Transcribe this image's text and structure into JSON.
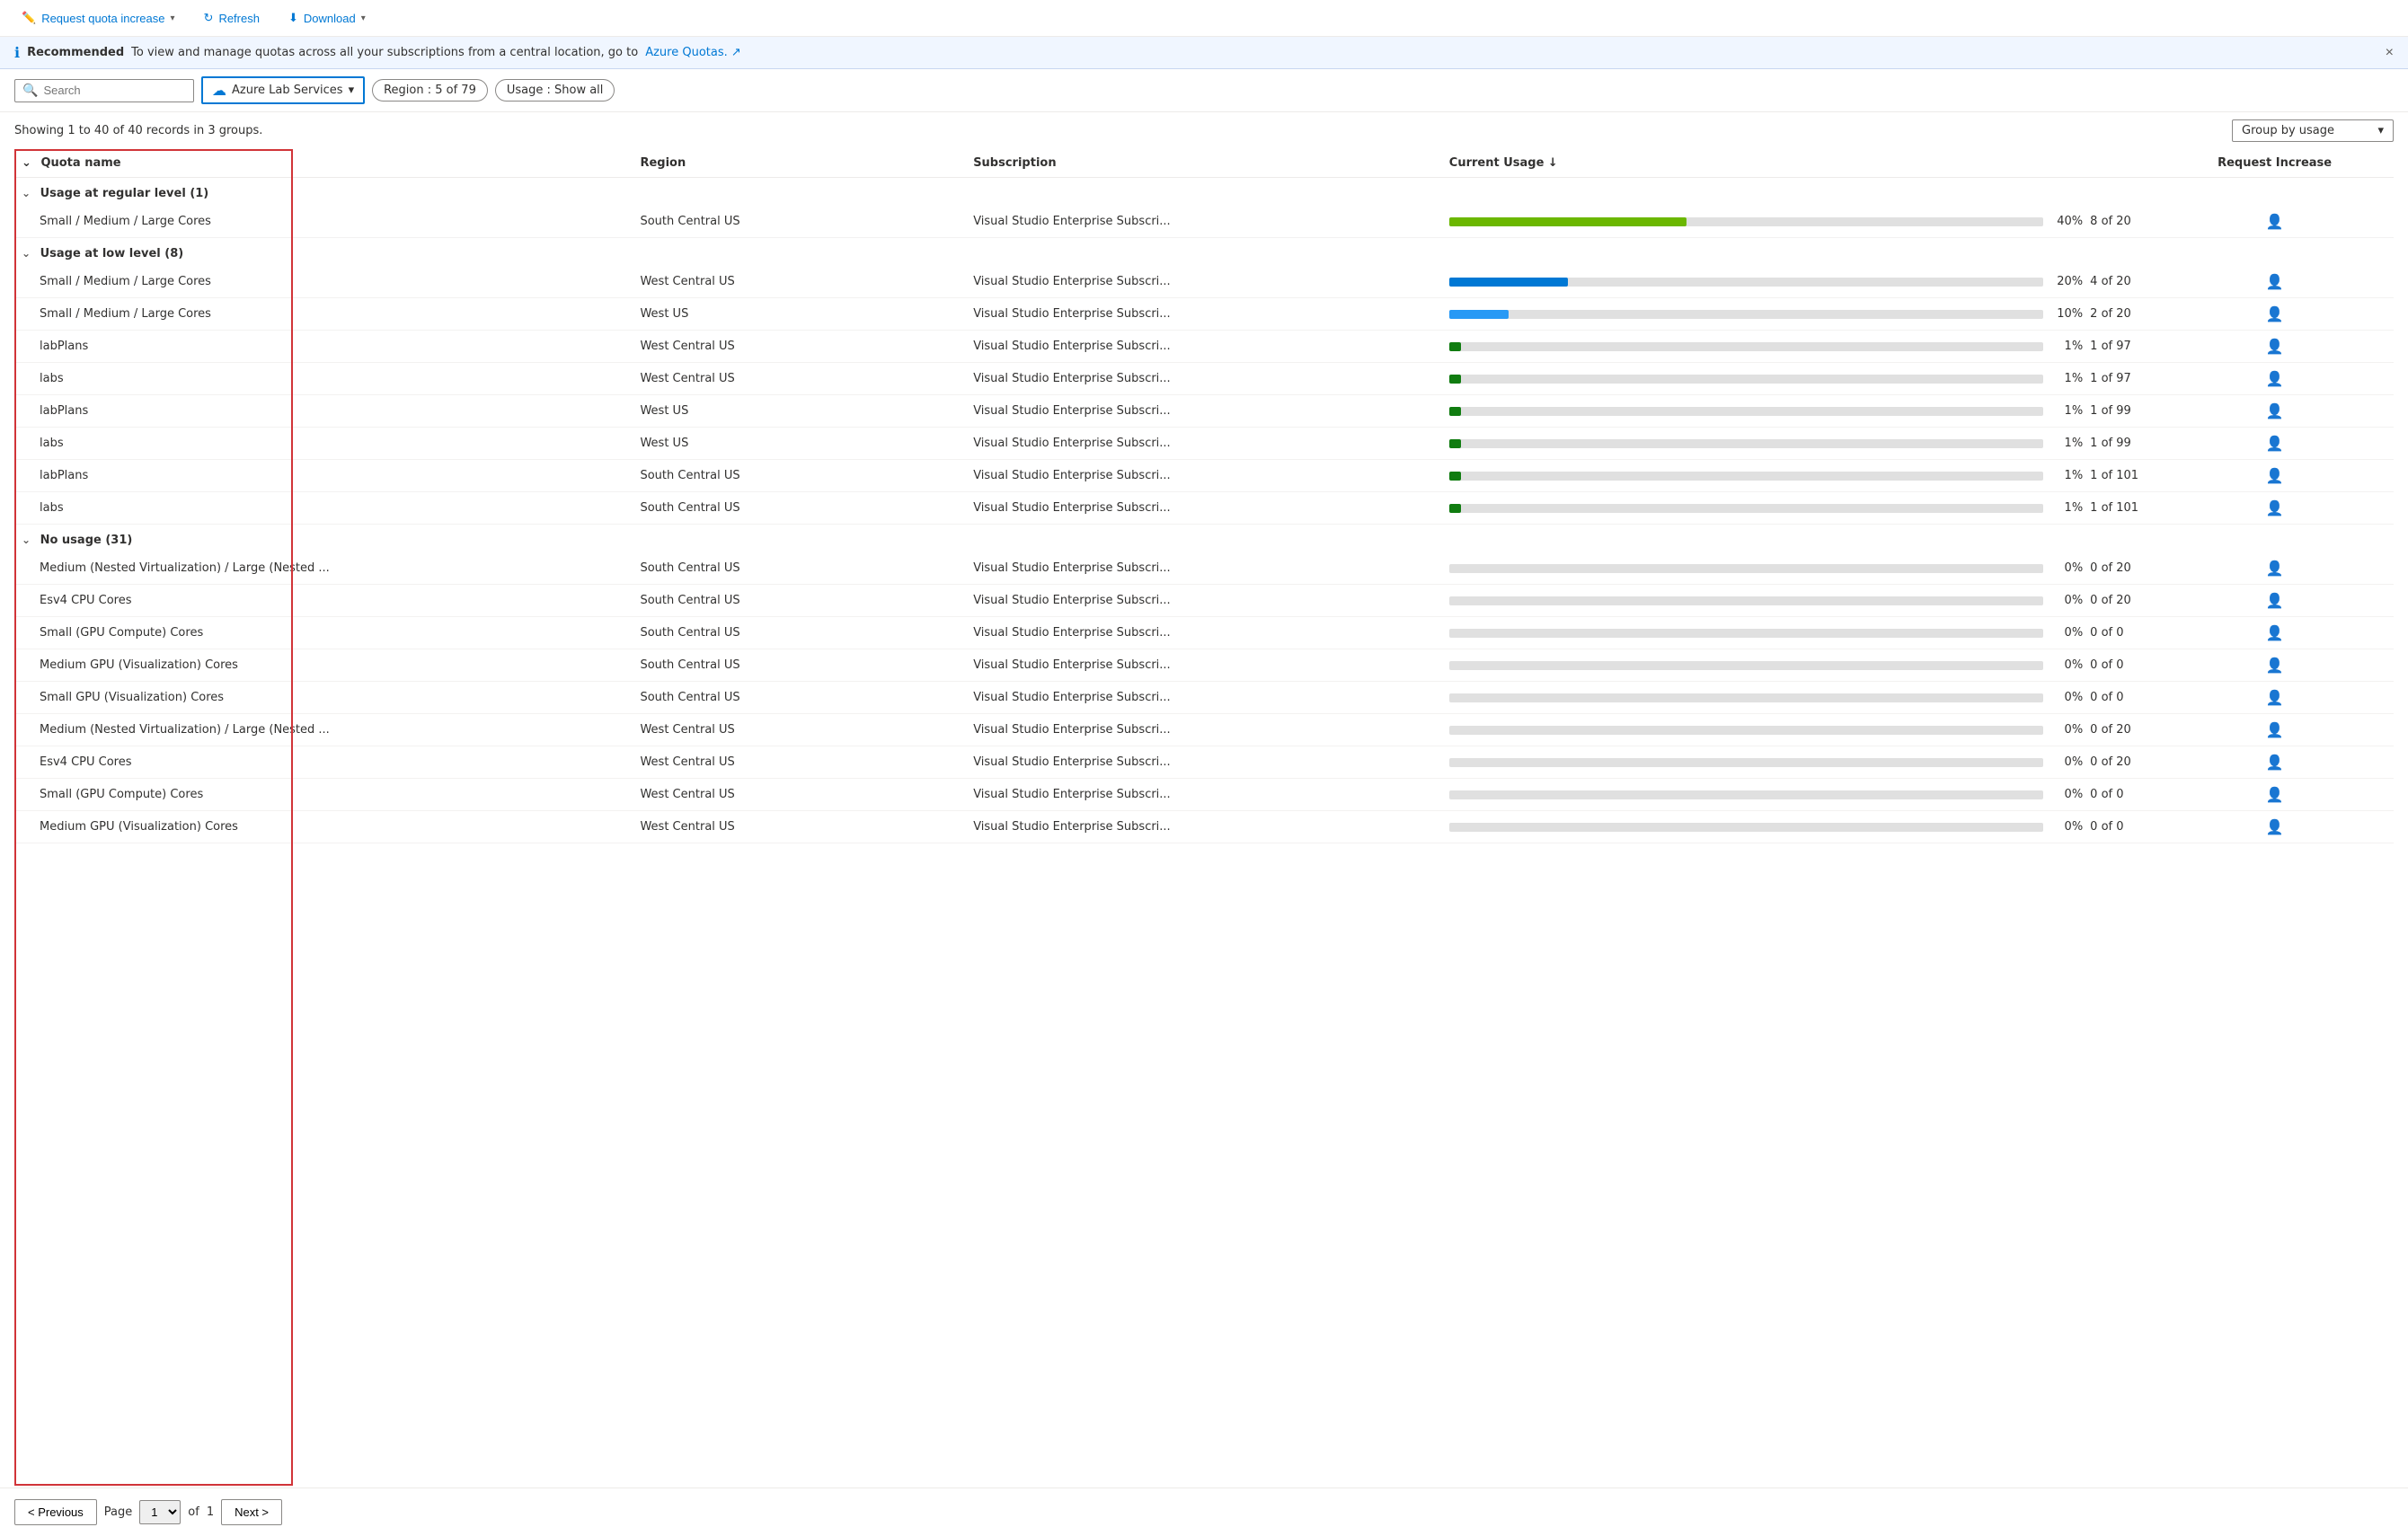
{
  "toolbar": {
    "request_quota_label": "Request quota increase",
    "refresh_label": "Refresh",
    "download_label": "Download"
  },
  "banner": {
    "badge": "Recommended",
    "text": "To view and manage quotas across all your subscriptions from a central location, go to",
    "link_text": "Azure Quotas.",
    "close_label": "×"
  },
  "filter_bar": {
    "search_placeholder": "Search",
    "service_label": "Azure Lab Services",
    "region_label": "Region : 5 of 79",
    "usage_label": "Usage : Show all"
  },
  "summary": {
    "text": "Showing 1 to 40 of 40 records in 3 groups.",
    "group_by_label": "Group by usage"
  },
  "table": {
    "headers": {
      "name": "Quota name",
      "region": "Region",
      "subscription": "Subscription",
      "current_usage": "Current Usage ↓",
      "request_increase": "Request Increase"
    },
    "groups": [
      {
        "id": "regular",
        "label": "Usage at regular level (1)",
        "collapsed": false,
        "rows": [
          {
            "name": "Small / Medium / Large Cores",
            "region": "South Central US",
            "subscription": "Visual Studio Enterprise Subscri...",
            "pct": 40,
            "bar_color": "green",
            "pct_label": "40%",
            "count": "8 of 20"
          }
        ]
      },
      {
        "id": "low",
        "label": "Usage at low level (8)",
        "collapsed": false,
        "rows": [
          {
            "name": "Small / Medium / Large Cores",
            "region": "West Central US",
            "subscription": "Visual Studio Enterprise Subscri...",
            "pct": 20,
            "bar_color": "blue-dark",
            "pct_label": "20%",
            "count": "4 of 20"
          },
          {
            "name": "Small / Medium / Large Cores",
            "region": "West US",
            "subscription": "Visual Studio Enterprise Subscri...",
            "pct": 10,
            "bar_color": "blue-light",
            "pct_label": "10%",
            "count": "2 of 20"
          },
          {
            "name": "labPlans",
            "region": "West Central US",
            "subscription": "Visual Studio Enterprise Subscri...",
            "pct": 1,
            "bar_color": "teal",
            "pct_label": "1%",
            "count": "1 of 97"
          },
          {
            "name": "labs",
            "region": "West Central US",
            "subscription": "Visual Studio Enterprise Subscri...",
            "pct": 1,
            "bar_color": "teal",
            "pct_label": "1%",
            "count": "1 of 97"
          },
          {
            "name": "labPlans",
            "region": "West US",
            "subscription": "Visual Studio Enterprise Subscri...",
            "pct": 1,
            "bar_color": "teal",
            "pct_label": "1%",
            "count": "1 of 99"
          },
          {
            "name": "labs",
            "region": "West US",
            "subscription": "Visual Studio Enterprise Subscri...",
            "pct": 1,
            "bar_color": "teal",
            "pct_label": "1%",
            "count": "1 of 99"
          },
          {
            "name": "labPlans",
            "region": "South Central US",
            "subscription": "Visual Studio Enterprise Subscri...",
            "pct": 1,
            "bar_color": "teal",
            "pct_label": "1%",
            "count": "1 of 101"
          },
          {
            "name": "labs",
            "region": "South Central US",
            "subscription": "Visual Studio Enterprise Subscri...",
            "pct": 1,
            "bar_color": "teal",
            "pct_label": "1%",
            "count": "1 of 101"
          }
        ]
      },
      {
        "id": "no-usage",
        "label": "No usage (31)",
        "collapsed": false,
        "rows": [
          {
            "name": "Medium (Nested Virtualization) / Large (Nested ...",
            "region": "South Central US",
            "subscription": "Visual Studio Enterprise Subscri...",
            "pct": 0,
            "bar_color": "gray",
            "pct_label": "0%",
            "count": "0 of 20"
          },
          {
            "name": "Esv4 CPU Cores",
            "region": "South Central US",
            "subscription": "Visual Studio Enterprise Subscri...",
            "pct": 0,
            "bar_color": "gray",
            "pct_label": "0%",
            "count": "0 of 20"
          },
          {
            "name": "Small (GPU Compute) Cores",
            "region": "South Central US",
            "subscription": "Visual Studio Enterprise Subscri...",
            "pct": 0,
            "bar_color": "gray",
            "pct_label": "0%",
            "count": "0 of 0"
          },
          {
            "name": "Medium GPU (Visualization) Cores",
            "region": "South Central US",
            "subscription": "Visual Studio Enterprise Subscri...",
            "pct": 0,
            "bar_color": "gray",
            "pct_label": "0%",
            "count": "0 of 0"
          },
          {
            "name": "Small GPU (Visualization) Cores",
            "region": "South Central US",
            "subscription": "Visual Studio Enterprise Subscri...",
            "pct": 0,
            "bar_color": "gray",
            "pct_label": "0%",
            "count": "0 of 0"
          },
          {
            "name": "Medium (Nested Virtualization) / Large (Nested ...",
            "region": "West Central US",
            "subscription": "Visual Studio Enterprise Subscri...",
            "pct": 0,
            "bar_color": "gray",
            "pct_label": "0%",
            "count": "0 of 20"
          },
          {
            "name": "Esv4 CPU Cores",
            "region": "West Central US",
            "subscription": "Visual Studio Enterprise Subscri...",
            "pct": 0,
            "bar_color": "gray",
            "pct_label": "0%",
            "count": "0 of 20"
          },
          {
            "name": "Small (GPU Compute) Cores",
            "region": "West Central US",
            "subscription": "Visual Studio Enterprise Subscri...",
            "pct": 0,
            "bar_color": "gray",
            "pct_label": "0%",
            "count": "0 of 0"
          },
          {
            "name": "Medium GPU (Visualization) Cores",
            "region": "West Central US",
            "subscription": "Visual Studio Enterprise Subscri...",
            "pct": 0,
            "bar_color": "gray",
            "pct_label": "0%",
            "count": "0 of 0"
          }
        ]
      }
    ]
  },
  "pagination": {
    "previous_label": "< Previous",
    "next_label": "Next >",
    "page_label": "Page",
    "current_page": "1",
    "total_pages": "1",
    "of_label": "of"
  }
}
